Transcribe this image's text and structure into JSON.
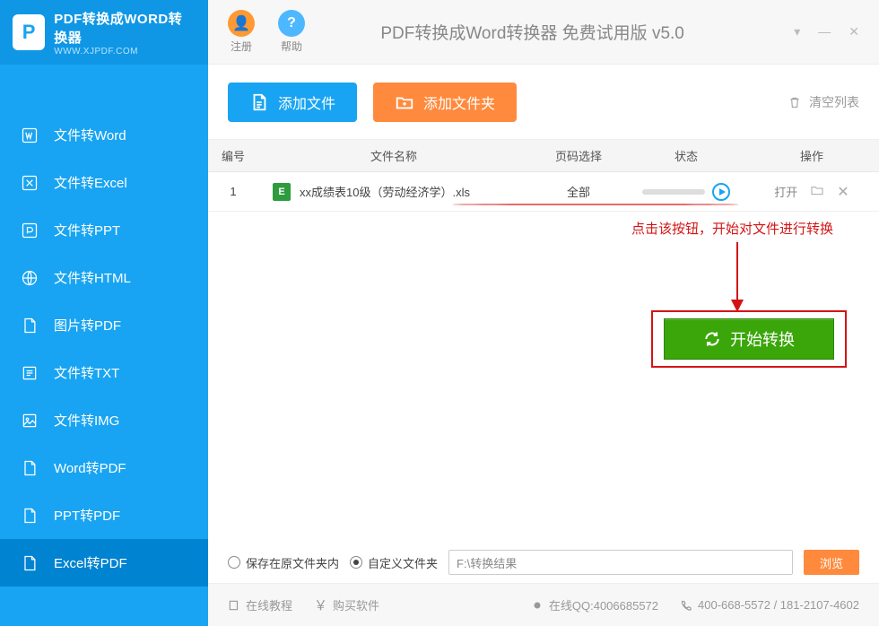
{
  "logo": {
    "title": "PDF转换成WORD转换器",
    "subtitle": "WWW.XJPDF.COM",
    "glyph": "P"
  },
  "titlebar": {
    "register": "注册",
    "help": "帮助",
    "title": "PDF转换成Word转换器 免费试用版 v5.0"
  },
  "sidebar": {
    "items": [
      {
        "label": "文件转Word"
      },
      {
        "label": "文件转Excel"
      },
      {
        "label": "文件转PPT"
      },
      {
        "label": "文件转HTML"
      },
      {
        "label": "图片转PDF"
      },
      {
        "label": "文件转TXT"
      },
      {
        "label": "文件转IMG"
      },
      {
        "label": "Word转PDF"
      },
      {
        "label": "PPT转PDF"
      },
      {
        "label": "Excel转PDF"
      }
    ]
  },
  "toolbar": {
    "add_file": "添加文件",
    "add_folder": "添加文件夹",
    "clear": "清空列表"
  },
  "table": {
    "headers": {
      "num": "编号",
      "name": "文件名称",
      "page": "页码选择",
      "status": "状态",
      "op": "操作"
    },
    "rows": [
      {
        "num": "1",
        "icon": "E",
        "name": "xx成绩表10级（劳动经济学）.xls",
        "page": "全部",
        "open": "打开"
      }
    ]
  },
  "annotation": "点击该按钮，开始对文件进行转换",
  "convert": "开始转换",
  "save": {
    "opt1": "保存在原文件夹内",
    "opt2": "自定义文件夹",
    "path": "F:\\转换结果",
    "browse": "浏览"
  },
  "footer": {
    "tutorial": "在线教程",
    "buy": "购买软件",
    "qq": "在线QQ:4006685572",
    "phone": "400-668-5572 / 181-2107-4602"
  }
}
